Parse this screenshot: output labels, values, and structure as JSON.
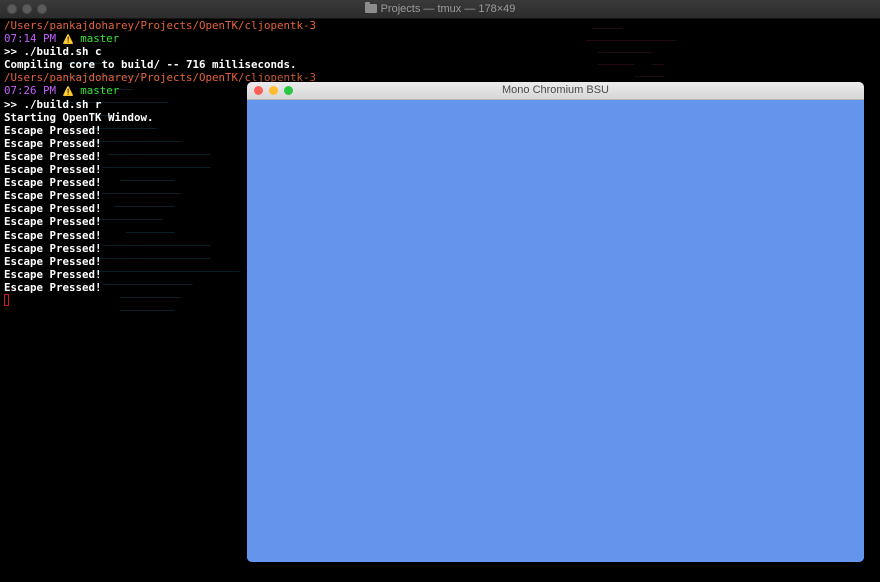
{
  "terminal": {
    "title": "Projects — tmux — 178×49",
    "title_icon": "folder-icon",
    "lines": [
      [
        {
          "text": "/Users/pankajdoharey/Projects/OpenTK/cljopentk-3",
          "style": "path"
        }
      ],
      [
        {
          "text": "07:14 PM ",
          "style": "time"
        },
        {
          "text": "⚠️",
          "style": "warn"
        },
        {
          "text": " master",
          "style": "branch"
        }
      ],
      [
        {
          "text": ">> ./build.sh c",
          "style": "plain"
        }
      ],
      [
        {
          "text": "Compiling core to build/ -- 716 milliseconds.",
          "style": "plain"
        }
      ],
      [
        {
          "text": "/Users/pankajdoharey/Projects/OpenTK/cljopentk-3",
          "style": "path"
        }
      ],
      [
        {
          "text": "07:26 PM ",
          "style": "time"
        },
        {
          "text": "⚠️",
          "style": "warn"
        },
        {
          "text": " master",
          "style": "branch"
        }
      ],
      [
        {
          "text": ">> ./build.sh r",
          "style": "plain"
        }
      ],
      [
        {
          "text": "Starting OpenTK Window.",
          "style": "plain"
        }
      ],
      [
        {
          "text": "Escape Pressed!",
          "style": "plain"
        }
      ],
      [
        {
          "text": "Escape Pressed!",
          "style": "plain"
        }
      ],
      [
        {
          "text": "Escape Pressed!",
          "style": "plain"
        }
      ],
      [
        {
          "text": "Escape Pressed!",
          "style": "plain"
        }
      ],
      [
        {
          "text": "Escape Pressed!",
          "style": "plain"
        }
      ],
      [
        {
          "text": "Escape Pressed!",
          "style": "plain"
        }
      ],
      [
        {
          "text": "Escape Pressed!",
          "style": "plain"
        }
      ],
      [
        {
          "text": "Escape Pressed!",
          "style": "plain"
        }
      ],
      [
        {
          "text": "Escape Pressed!",
          "style": "plain"
        }
      ],
      [
        {
          "text": "Escape Pressed!",
          "style": "plain"
        }
      ],
      [
        {
          "text": "Escape Pressed!",
          "style": "plain"
        }
      ],
      [
        {
          "text": "Escape Pressed!",
          "style": "plain"
        }
      ],
      [
        {
          "text": "Escape Pressed!",
          "style": "plain"
        }
      ]
    ],
    "colors": {
      "background": "#000000",
      "path": "#e5633a",
      "time": "#c760ff",
      "branch": "#35e135",
      "warn": "#ffd700",
      "text": "#ffffff",
      "cursor": "#d11a1a"
    }
  },
  "app_window": {
    "title": "Mono Chromium BSU",
    "canvas_color": "#6495ed",
    "traffic_lights": [
      "#fe5f57",
      "#febc2e",
      "#28c840"
    ]
  }
}
